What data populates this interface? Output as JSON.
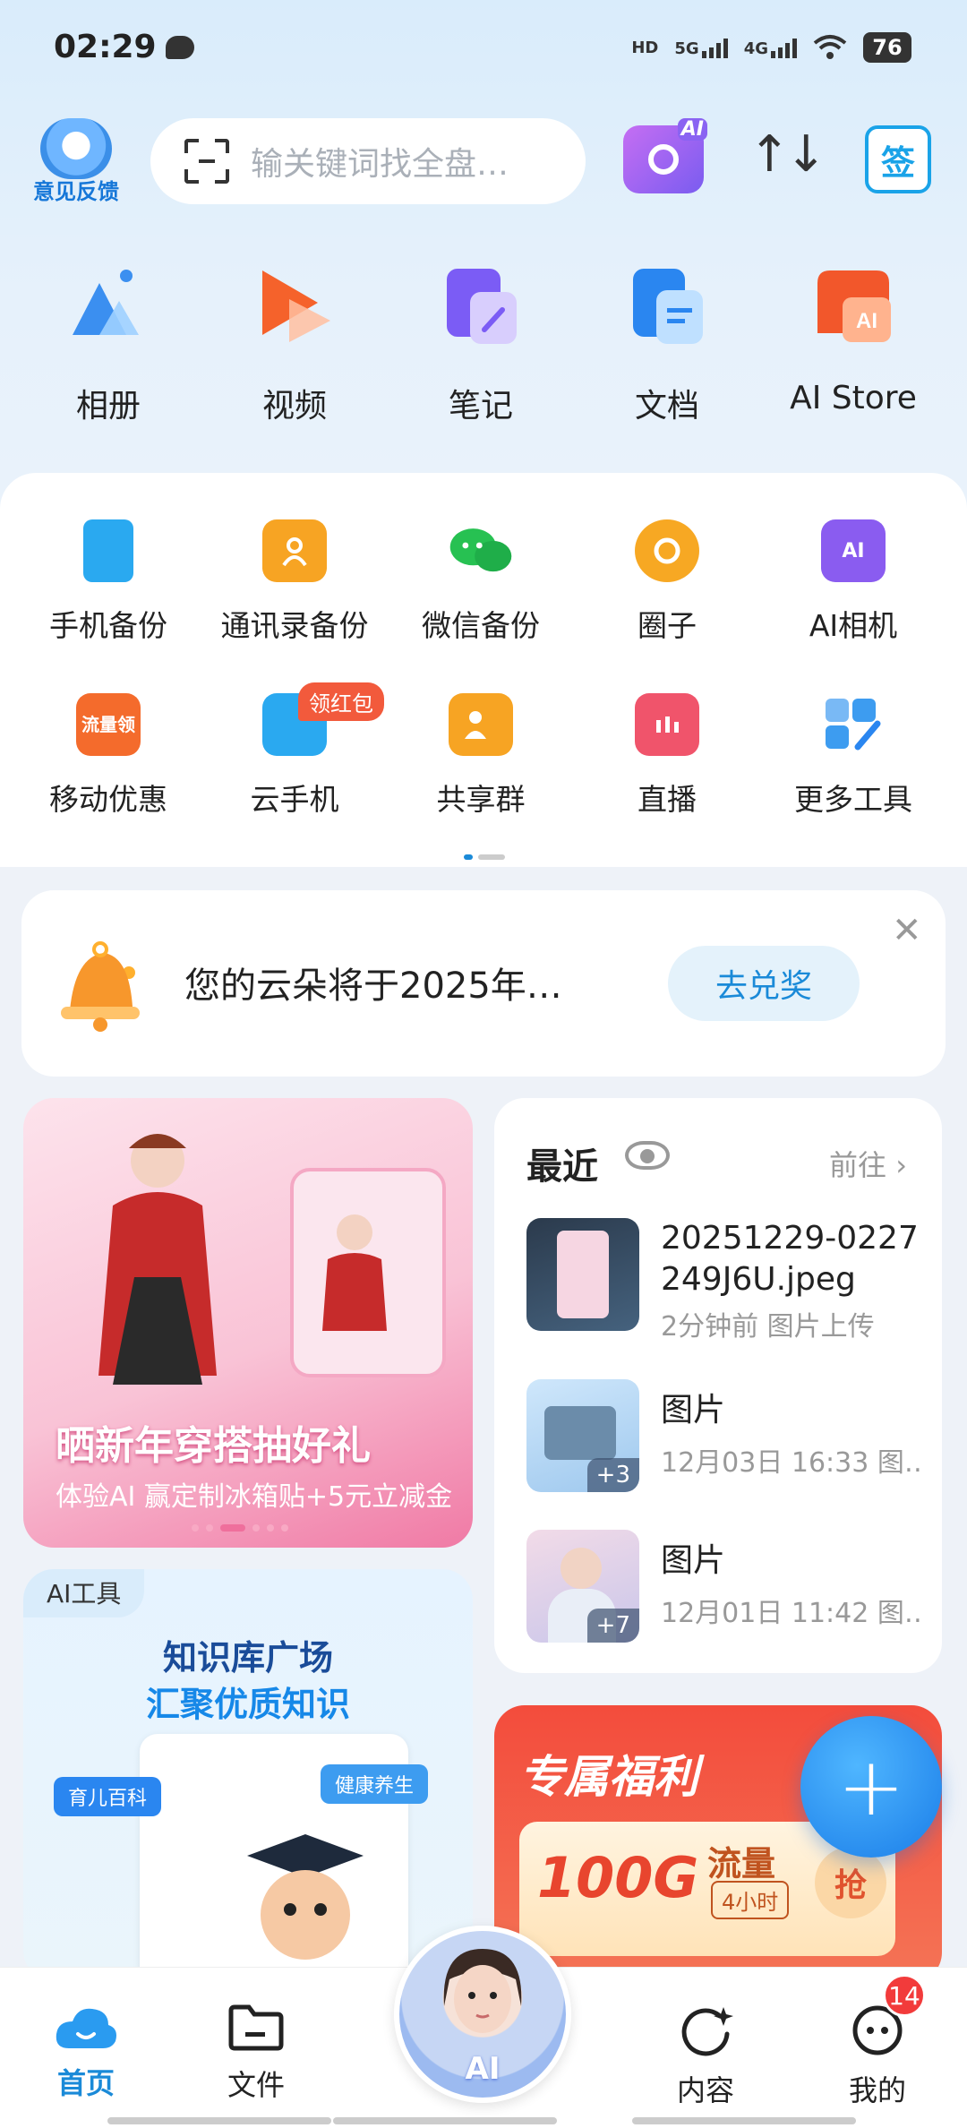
{
  "status_bar": {
    "time": "02:29",
    "net1": "5G",
    "net2": "4G",
    "hd": "HD",
    "battery": "76"
  },
  "header": {
    "feedback_label": "意见反馈",
    "search_placeholder": "输关键词找全盘…",
    "sign_label": "签",
    "ai_camera_label": "AI"
  },
  "main_shortcuts": [
    {
      "label": "相册",
      "icon": "album-icon"
    },
    {
      "label": "视频",
      "icon": "video-icon"
    },
    {
      "label": "笔记",
      "icon": "note-icon"
    },
    {
      "label": "文档",
      "icon": "document-icon"
    },
    {
      "label": "AI Store",
      "icon": "ai-store-icon"
    }
  ],
  "tools_row1": [
    {
      "label": "手机备份",
      "icon": "phone-backup-icon",
      "color": "#2aa9f0"
    },
    {
      "label": "通讯录备份",
      "icon": "contacts-backup-icon",
      "color": "#f7a423"
    },
    {
      "label": "微信备份",
      "icon": "wechat-backup-icon",
      "color": "#27c152"
    },
    {
      "label": "圈子",
      "icon": "circle-icon",
      "color": "#f7a823"
    },
    {
      "label": "AI相机",
      "icon": "ai-camera-icon",
      "color": "#8a5cf0"
    }
  ],
  "tools_row2": [
    {
      "label": "移动优惠",
      "icon": "mobile-discount-icon",
      "color": "#f46b2c",
      "glyph": "流量领"
    },
    {
      "label": "云手机",
      "icon": "cloud-phone-icon",
      "color": "#2aa9f0",
      "badge": "领红包"
    },
    {
      "label": "共享群",
      "icon": "share-group-icon",
      "color": "#f7a423"
    },
    {
      "label": "直播",
      "icon": "live-icon",
      "color": "#f0546b"
    },
    {
      "label": "更多工具",
      "icon": "more-tools-icon",
      "color": "#3d9cf0"
    }
  ],
  "notice": {
    "text": "您的云朵将于2025年…",
    "button": "去兑奖"
  },
  "promo": {
    "title": "晒新年穿搭抽好礼",
    "subtitle": "体验AI 赢定制冰箱贴+5元立减金"
  },
  "recent": {
    "title": "最近",
    "go": "前往",
    "items": [
      {
        "name": "20251229-0227249J6U.jpeg",
        "time": "2分钟前",
        "source": "图片上传",
        "more": ""
      },
      {
        "name": "图片",
        "time": "12月03日 16:33",
        "source": "图…",
        "more": "+3"
      },
      {
        "name": "图片",
        "time": "12月01日 11:42",
        "source": "图…",
        "more": "+7"
      }
    ]
  },
  "ai_tool": {
    "tag": "AI工具",
    "line1": "知识库广场",
    "line2": "汇聚优质知识",
    "chip1": "育儿百科",
    "chip2": "健康养生"
  },
  "welfare": {
    "title": "专属福利",
    "amount": "100G",
    "flow": "流量",
    "duration": "4小时",
    "grab": "抢"
  },
  "fab": {
    "label": "+"
  },
  "nav": {
    "home": "首页",
    "files": "文件",
    "ai": "AI",
    "content": "内容",
    "mine": "我的",
    "mine_badge": "14"
  },
  "colors": {
    "accent": "#1a8ad8",
    "badge": "#f23b3b"
  }
}
